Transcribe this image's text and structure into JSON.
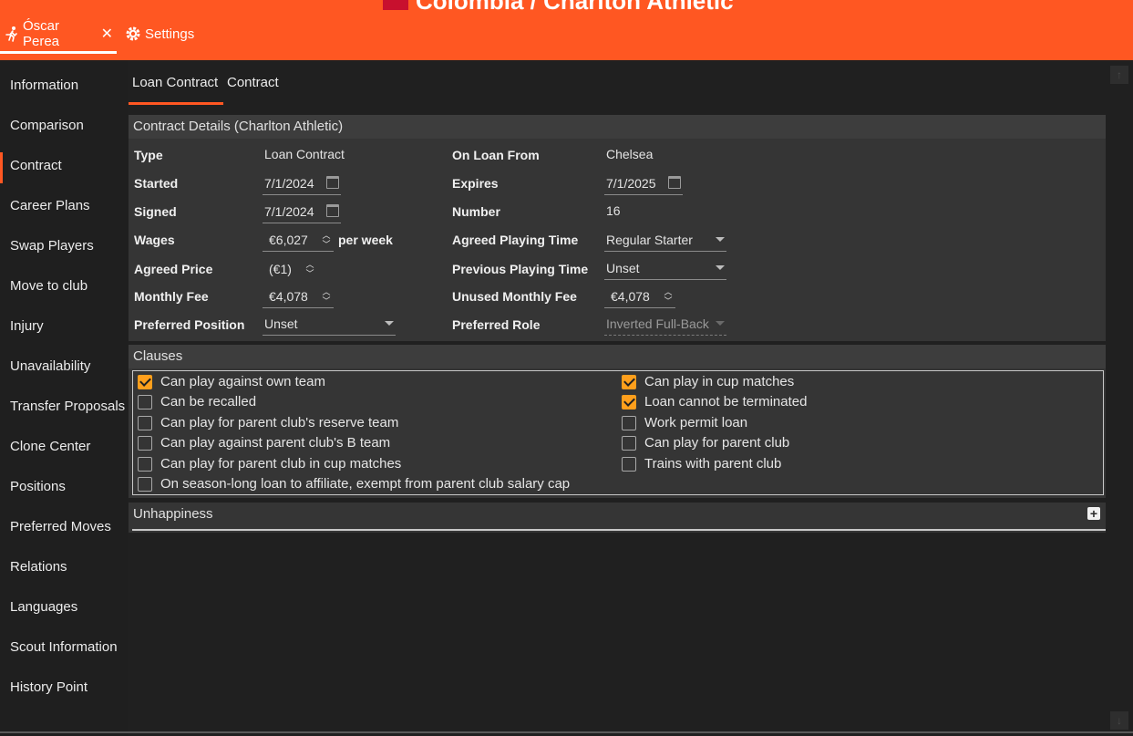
{
  "header": {
    "title": "Colombia / Charlton Athletic",
    "tabs": {
      "player": "Óscar Perea",
      "settings": "Settings"
    }
  },
  "sidebar": {
    "items": [
      "Information",
      "Comparison",
      "Contract",
      "Career Plans",
      "Swap Players",
      "Move to club",
      "Injury",
      "Unavailability",
      "Transfer Proposals",
      "Clone Center",
      "Positions",
      "Preferred Moves",
      "Relations",
      "Languages",
      "Scout Information",
      "History Point"
    ],
    "active": "Contract"
  },
  "subtabs": {
    "loan": "Loan Contract",
    "contract": "Contract"
  },
  "contract": {
    "header": "Contract Details (Charlton Athletic)",
    "type": {
      "label": "Type",
      "value": "Loan Contract"
    },
    "started": {
      "label": "Started",
      "value": "7/1/2024"
    },
    "signed": {
      "label": "Signed",
      "value": "7/1/2024"
    },
    "wages": {
      "label": "Wages",
      "value": "€6,027",
      "suffix": "per week"
    },
    "agreed_price": {
      "label": "Agreed Price",
      "value": "(€1)"
    },
    "monthly_fee": {
      "label": "Monthly Fee",
      "value": "€4,078"
    },
    "preferred_position": {
      "label": "Preferred Position",
      "value": "Unset"
    },
    "on_loan_from": {
      "label": "On Loan From",
      "value": "Chelsea"
    },
    "expires": {
      "label": "Expires",
      "value": "7/1/2025"
    },
    "number": {
      "label": "Number",
      "value": "16"
    },
    "agreed_playing_time": {
      "label": "Agreed Playing Time",
      "value": "Regular Starter"
    },
    "previous_playing_time": {
      "label": "Previous Playing Time",
      "value": "Unset"
    },
    "unused_monthly_fee": {
      "label": "Unused Monthly Fee",
      "value": "€4,078"
    },
    "preferred_role": {
      "label": "Preferred Role",
      "value": "Inverted Full-Back"
    }
  },
  "clauses": {
    "header": "Clauses",
    "left": [
      {
        "label": "Can play against own team",
        "checked": true
      },
      {
        "label": "Can be recalled",
        "checked": false
      },
      {
        "label": "Can play for parent club's reserve team",
        "checked": false
      },
      {
        "label": "Can play against parent club's B team",
        "checked": false
      },
      {
        "label": "Can play for parent club in cup matches",
        "checked": false
      },
      {
        "label": "On season-long loan to affiliate, exempt from parent club salary cap",
        "checked": false
      }
    ],
    "right": [
      {
        "label": "Can play in cup matches",
        "checked": true
      },
      {
        "label": "Loan cannot be terminated",
        "checked": true
      },
      {
        "label": "Work permit loan",
        "checked": false
      },
      {
        "label": "Can play for parent club",
        "checked": false
      },
      {
        "label": "Trains with parent club",
        "checked": false
      }
    ]
  },
  "unhappiness": {
    "header": "Unhappiness",
    "expand": "+"
  },
  "colors": {
    "accent": "#ff5722",
    "checkbox": "#ff9f1c",
    "background": "#202020",
    "panel": "#353535"
  },
  "icons": {
    "player": "running-player-icon",
    "settings": "gear-icon",
    "close": "close-icon",
    "calendar": "calendar-icon"
  }
}
